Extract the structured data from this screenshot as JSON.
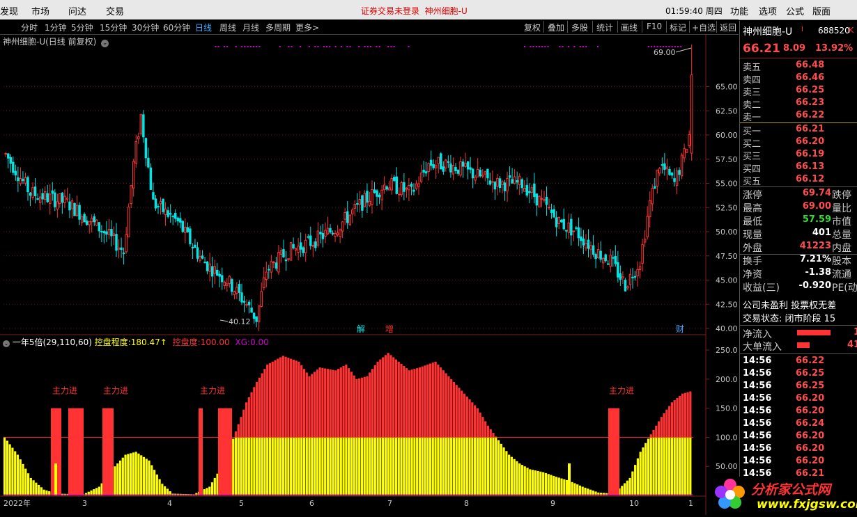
{
  "topbar": {
    "menu": [
      "发现",
      "市场",
      "问达",
      "交易"
    ],
    "status": "证券交易未登录",
    "stock": "神州细胞-U",
    "clock": "01:59:40 周四",
    "right_menu": [
      "功能",
      "选项",
      "公式",
      "版面"
    ]
  },
  "toolbar": {
    "periods": [
      "分时",
      "1分钟",
      "5分钟",
      "15分钟",
      "30分钟",
      "60分钟",
      "日线",
      "周线",
      "月线",
      "多周期",
      "更多>"
    ],
    "active": "日线",
    "right": [
      "复权",
      "叠加",
      "多股",
      "统计",
      "画线",
      "F10",
      "标记",
      "+自选",
      "返回"
    ]
  },
  "chart_header": {
    "title": "神州细胞-U(日线 前复权)"
  },
  "indicator_header": {
    "name": "一年5倍(29,110,60)",
    "kpcd_label": "控盘程度:",
    "kpcd_value": "180.47↑",
    "kpd_label": "控盘度:",
    "kpd_value": "100.00",
    "xg_label": "XG:",
    "xg_value": "0.00"
  },
  "chart_data": [
    {
      "type": "candlestick",
      "y_ticks": [
        "65.00",
        "62.50",
        "60.00",
        "57.50",
        "55.00",
        "52.50",
        "50.00",
        "47.50",
        "45.00",
        "42.50",
        "40.00"
      ],
      "ylim": [
        40,
        69.5
      ],
      "annotations": {
        "high": "69.00",
        "low": "40.12",
        "events": [
          "解",
          "增",
          "财"
        ]
      },
      "x_ticks": [
        "2022年",
        "3",
        "4",
        "5",
        "6",
        "7",
        "8",
        "9",
        "10",
        "1"
      ]
    },
    {
      "type": "bar",
      "y_ticks": [
        "250.0",
        "200.0",
        "150.0",
        "100.0",
        "50.00"
      ],
      "ylim": [
        0,
        250
      ],
      "labels": [
        "主力进",
        "主力进",
        "主力进",
        "主力进"
      ]
    }
  ],
  "sidebar": {
    "name": "神州细胞-U",
    "code": "688520",
    "price": "66.21",
    "change": "8.09",
    "pct": "13.92%",
    "sell": [
      {
        "label": "卖五",
        "value": "66.48"
      },
      {
        "label": "卖四",
        "value": "66.46"
      },
      {
        "label": "卖三",
        "value": "66.25"
      },
      {
        "label": "卖二",
        "value": "66.23"
      },
      {
        "label": "卖一",
        "value": "66.22"
      }
    ],
    "buy": [
      {
        "label": "买一",
        "value": "66.21"
      },
      {
        "label": "买二",
        "value": "66.20"
      },
      {
        "label": "买三",
        "value": "66.19"
      },
      {
        "label": "买四",
        "value": "66.13"
      },
      {
        "label": "买五",
        "value": "66.12"
      }
    ],
    "stats": [
      {
        "label": "涨停",
        "value": "69.74",
        "label2": "跌停"
      },
      {
        "label": "最高",
        "value": "69.00",
        "label2": "量比"
      },
      {
        "label": "最低",
        "value": "57.59",
        "label2": "市值"
      },
      {
        "label": "现量",
        "value": "401",
        "label2": "总量"
      },
      {
        "label": "外盘",
        "value": "41223",
        "label2": "内盘"
      },
      {
        "label": "换手",
        "value": "7.21%",
        "label2": "股本"
      },
      {
        "label": "净资",
        "value": "-1.38",
        "label2": "流通"
      },
      {
        "label": "收益(三)",
        "value": "-0.920",
        "label2": "PE(动)"
      }
    ],
    "info1": "公司未盈利 投票权无差",
    "info2": "交易状态: 闭市阶段 15",
    "flow": [
      {
        "label": "净流入",
        "value": "1"
      },
      {
        "label": "大单流入",
        "value": "41"
      }
    ],
    "ticks": [
      {
        "t": "14:56",
        "p": "66.22"
      },
      {
        "t": "14:56",
        "p": "66.25"
      },
      {
        "t": "14:56",
        "p": "66.25"
      },
      {
        "t": "14:56",
        "p": "66.20"
      },
      {
        "t": "14:56",
        "p": "66.20"
      },
      {
        "t": "14:56",
        "p": "66.24"
      },
      {
        "t": "14:56",
        "p": "66.20"
      },
      {
        "t": "14:56",
        "p": "66.20"
      },
      {
        "t": "14:56",
        "p": "66.20"
      },
      {
        "t": "14:56",
        "p": "66.21"
      }
    ]
  },
  "watermark": "分析家公式网www.fxjgsw.com",
  "logo": {
    "title": "分析家公式网",
    "url": "www.fxjgsw.com"
  },
  "colors": {
    "up": "#ff3333",
    "down": "#00e5e5",
    "yellow": "#ffff00",
    "accent": "#3ea8ff"
  }
}
